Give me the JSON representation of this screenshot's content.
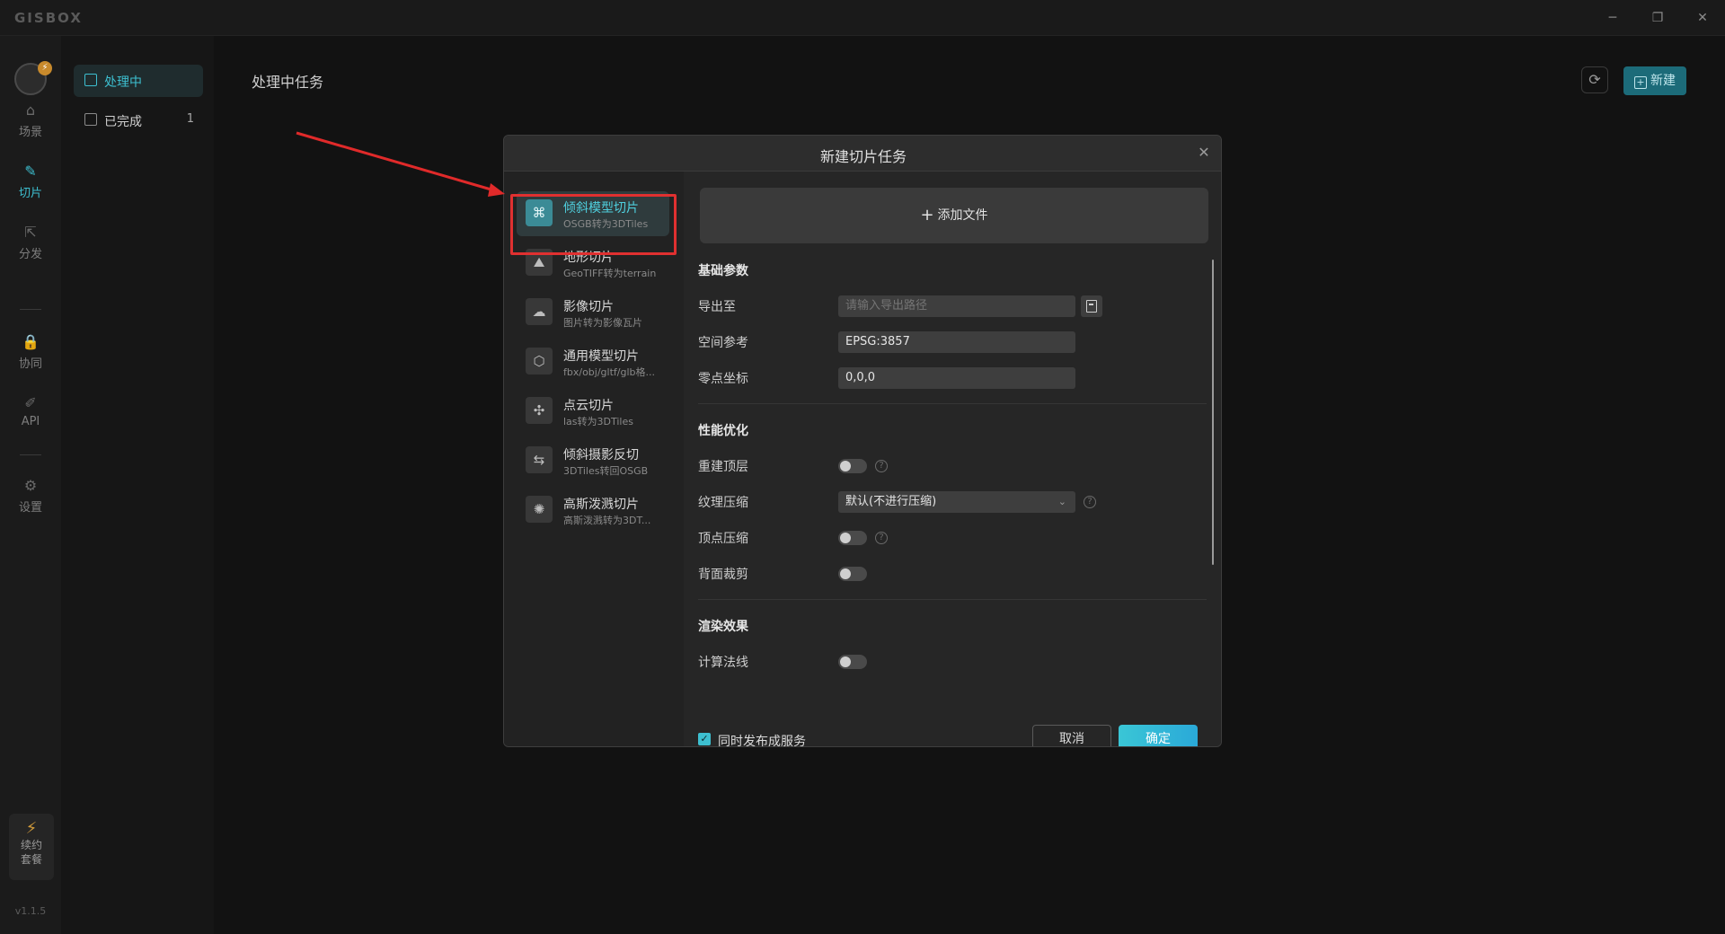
{
  "app": {
    "brand": "GISBOX",
    "window": {
      "minimize": "─",
      "maximize": "❐",
      "close": "✕"
    }
  },
  "rail": {
    "avatar_badge": "⚡",
    "items": [
      {
        "label": "场景",
        "icon": "home-icon",
        "glyph": "⌂"
      },
      {
        "label": "切片",
        "icon": "slice-icon",
        "glyph": "✎"
      },
      {
        "label": "分发",
        "icon": "share-icon",
        "glyph": "⇱"
      },
      {
        "label": "协同",
        "icon": "lock-icon",
        "glyph": "🔒"
      },
      {
        "label": "API",
        "icon": "api-icon",
        "glyph": "✐"
      },
      {
        "label": "设置",
        "icon": "gear-icon",
        "glyph": "⚙"
      }
    ],
    "renew": {
      "glyph": "⚡",
      "line1": "续约",
      "line2": "套餐"
    },
    "version": "v1.1.5"
  },
  "subnav": {
    "items": [
      {
        "label": "处理中",
        "count": ""
      },
      {
        "label": "已完成",
        "count": "1"
      }
    ]
  },
  "main": {
    "title": "处理中任务",
    "refresh_glyph": "⟳",
    "new_label": "新建",
    "new_glyph": "+"
  },
  "modal": {
    "title": "新建切片任务",
    "close_glyph": "✕",
    "categories": [
      {
        "name": "倾斜模型切片",
        "desc": "OSGB转为3DTiles",
        "glyph": "⌘"
      },
      {
        "name": "地形切片",
        "desc": "GeoTIFF转为terrain",
        "glyph": "⛰"
      },
      {
        "name": "影像切片",
        "desc": "图片转为影像瓦片",
        "glyph": "☁"
      },
      {
        "name": "通用模型切片",
        "desc": "fbx/obj/gltf/glb格...",
        "glyph": "⬡"
      },
      {
        "name": "点云切片",
        "desc": "las转为3DTiles",
        "glyph": "✣"
      },
      {
        "name": "倾斜摄影反切",
        "desc": "3DTiles转回OSGB",
        "glyph": "⇆"
      },
      {
        "name": "高斯泼溅切片",
        "desc": "高斯泼溅转为3DT...",
        "glyph": "✺"
      }
    ],
    "add_file": {
      "glyph": "+",
      "label": "添加文件"
    },
    "sections": {
      "basic": "基础参数",
      "perf": "性能优化",
      "render": "渲染效果"
    },
    "basic": {
      "export_label": "导出至",
      "export_placeholder": "请输入导出路径",
      "crs_label": "空间参考",
      "crs_value": "EPSG:3857",
      "origin_label": "零点坐标",
      "origin_value": "0,0,0"
    },
    "perf": {
      "rebuild_label": "重建顶层",
      "texture_label": "纹理压缩",
      "texture_value": "默认(不进行压缩)",
      "vertex_label": "顶点压缩",
      "backface_label": "背面裁剪"
    },
    "render": {
      "normals_label": "计算法线"
    },
    "help_glyph": "?",
    "chevron_glyph": "⌄",
    "footer": {
      "check_glyph": "✓",
      "publish_label": "同时发布成服务",
      "cancel": "取消",
      "ok": "确定"
    }
  }
}
